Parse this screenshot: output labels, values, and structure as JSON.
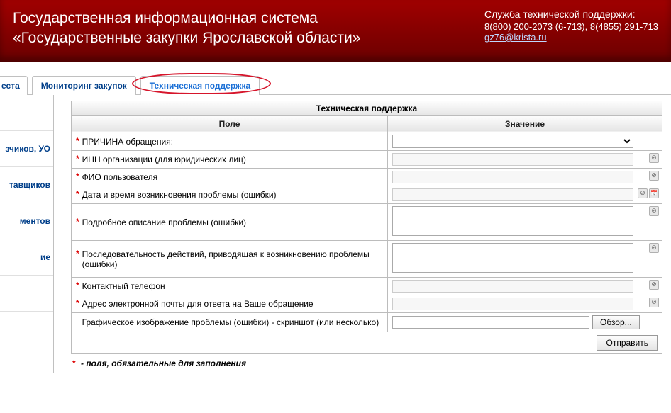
{
  "header": {
    "title_line1": "Государственная информационная система",
    "title_line2": "«Государственные закупки Ярославской области»",
    "support_title": "Служба технической поддержки:",
    "support_phones": "8(800) 200-2073 (6-713), 8(4855) 291-713",
    "support_email": "gz76@krista.ru"
  },
  "tabs": {
    "partial": "еста",
    "monitoring": "Мониторинг закупок",
    "support": "Техническая поддержка"
  },
  "sidebar": {
    "items": [
      "зчиков, УО",
      "тавщиков",
      "ментов",
      "ие"
    ]
  },
  "form": {
    "title": "Техническая поддержка",
    "col_field": "Поле",
    "col_value": "Значение",
    "rows": {
      "reason": "ПРИЧИНА обращения:",
      "inn": "ИНН организации (для юридических лиц)",
      "fio": "ФИО пользователя",
      "datetime": "Дата и время возникновения проблемы (ошибки)",
      "desc": "Подробное описание проблемы (ошибки)",
      "steps": "Последовательность действий, приводящая к возникновению проблемы (ошибки)",
      "phone": "Контактный телефон",
      "email": "Адрес электронной почты для ответа на Ваше обращение",
      "screenshot": "Графическое изображение проблемы (ошибки) - скриншот (или несколько)"
    },
    "browse": "Обзор...",
    "submit": "Отправить",
    "footnote": " - поля, обязательные для заполнения",
    "star": "*"
  }
}
